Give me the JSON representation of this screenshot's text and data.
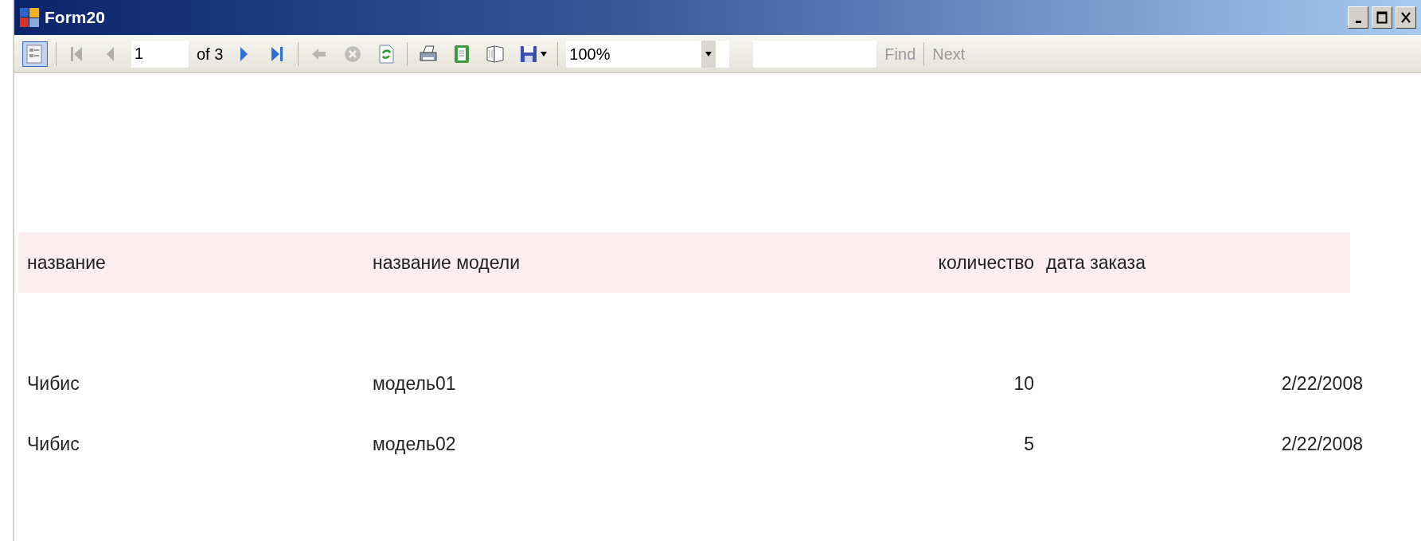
{
  "window": {
    "title": "Form20"
  },
  "toolbar": {
    "map_toggle": {
      "selected": true
    },
    "first_prev": [
      {
        "disabled": true
      },
      {
        "disabled": true
      }
    ],
    "page_field": {
      "value": "1"
    },
    "page_total": "of 3",
    "next_last": [
      {
        "disabled": false
      },
      {
        "disabled": false
      }
    ],
    "history": [
      {
        "disabled": true
      },
      {
        "disabled": true
      },
      {
        "disabled": false
      }
    ],
    "output": [
      {
        "disabled": false
      },
      {
        "disabled": false
      },
      {
        "disabled": false
      },
      {
        "disabled": false
      }
    ],
    "zoom": {
      "value": "100%"
    },
    "find": {
      "label": "Find",
      "disabled": true
    },
    "find_next": {
      "label": "Next",
      "disabled": true
    }
  },
  "report": {
    "columns": [
      "название",
      "название модели",
      "количество",
      "дата заказа"
    ],
    "rows": [
      [
        "Чибис",
        "модель01",
        "10",
        "2/22/2008"
      ],
      [
        "Чибис",
        "модель02",
        "5",
        "2/22/2008"
      ]
    ]
  }
}
